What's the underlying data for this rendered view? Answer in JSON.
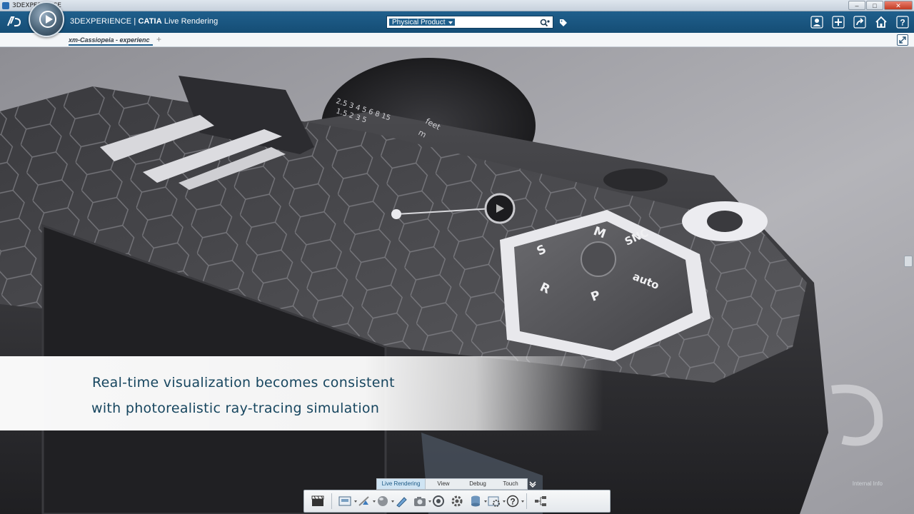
{
  "window": {
    "title": "3DEXPERIENCE",
    "controls": [
      "–",
      "□",
      "✕"
    ]
  },
  "header": {
    "brand_prefix": "3DEXPERIENCE | ",
    "brand_app": "CATIA",
    "brand_suffix": " Live Rendering",
    "search_scope": "Physical Product",
    "search_placeholder": "",
    "icons": [
      "user-icon",
      "plus-icon",
      "share-icon",
      "home-icon",
      "help-icon"
    ]
  },
  "tabs": {
    "document_tab": "xm-Cassiopeia - experienc",
    "add_tab": "+"
  },
  "viewport": {
    "caption_line1": "Real-time visualization becomes consistent",
    "caption_line2": "with photorealistic ray-tracing simulation",
    "watermark": "Internal Info",
    "dial_labels": [
      "M",
      "SNC",
      "auto",
      "P",
      "R",
      "S"
    ],
    "lens_numbers": "2.5 3 4 5 6 8 15",
    "lens_numbers2": "1.5 2 3 5",
    "lens_units": [
      "feet",
      "m"
    ]
  },
  "action_bar": {
    "tabs": [
      "Live Rendering",
      "View",
      "Debug",
      "Touch"
    ],
    "active_tab": "Live Rendering",
    "tools": [
      "clapper-icon",
      "render-icon",
      "sun-icon",
      "material-icon",
      "paint-icon",
      "camera-icon",
      "environment-icon",
      "settings-icon",
      "database-icon",
      "options-icon",
      "help-icon",
      "tree-icon"
    ]
  },
  "colors": {
    "header_blue": "#1f5f8c",
    "caption_text": "#17465f",
    "active_tab": "#cfe4f3"
  }
}
